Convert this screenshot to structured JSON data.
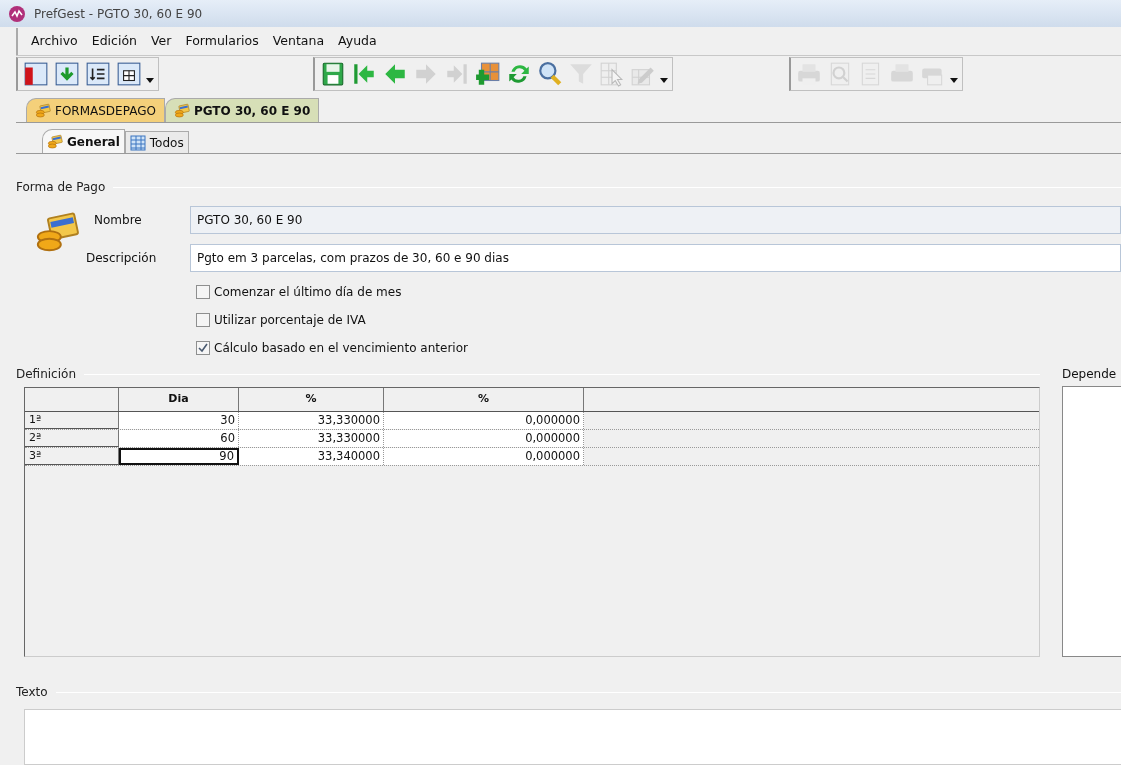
{
  "window": {
    "title": "PrefGest - PGTO 30, 60 E 90"
  },
  "menu": [
    "Archivo",
    "Edición",
    "Ver",
    "Formularios",
    "Ventana",
    "Ayuda"
  ],
  "toolbars": [
    {
      "items": [
        {
          "disabled": false
        },
        {
          "disabled": false
        },
        {
          "disabled": false
        },
        {
          "disabled": false
        }
      ]
    },
    {
      "items": [
        {
          "disabled": false
        },
        {
          "disabled": false
        },
        {
          "disabled": false
        },
        {
          "disabled": true
        },
        {
          "disabled": true
        },
        {
          "disabled": false
        },
        {
          "disabled": false
        },
        {
          "disabled": false
        },
        {
          "disabled": true
        },
        {
          "disabled": true
        },
        {
          "disabled": true
        }
      ]
    },
    {
      "items": [
        {
          "disabled": true
        },
        {
          "disabled": true
        },
        {
          "disabled": true
        },
        {
          "disabled": true
        },
        {
          "disabled": true
        }
      ]
    }
  ],
  "document_tabs": [
    {
      "label": "FORMASDEPAGO",
      "selected": false
    },
    {
      "label": "PGTO 30, 60 E 90",
      "selected": true
    }
  ],
  "tabs": [
    {
      "label": "General",
      "selected": true
    },
    {
      "label": "Todos",
      "selected": false
    }
  ],
  "forma_de_pago": {
    "legend": "Forma de Pago",
    "fields": [
      {
        "label": "Nombre",
        "value": "PGTO 30, 60 E 90"
      },
      {
        "label": "Descripción",
        "value": "Pgto em 3 parcelas, com prazos de 30, 60 e 90 dias"
      }
    ],
    "checkboxes": [
      {
        "label": "Comenzar el último día de mes",
        "checked": false
      },
      {
        "label": "Utilizar porcentaje de IVA",
        "checked": false
      },
      {
        "label": "Cálculo basado en el vencimiento anterior",
        "checked": true
      }
    ]
  },
  "definicion": {
    "legend": "Definición",
    "columns": [
      "Dia",
      "%",
      "%"
    ],
    "rows": [
      {
        "label": "1ª",
        "cells": [
          {
            "text": "30",
            "selected": false
          },
          {
            "text": "33,330000",
            "selected": false
          },
          {
            "text": "0,000000",
            "selected": false
          }
        ]
      },
      {
        "label": "2ª",
        "cells": [
          {
            "text": "60",
            "selected": false
          },
          {
            "text": "33,330000",
            "selected": false
          },
          {
            "text": "0,000000",
            "selected": false
          }
        ]
      },
      {
        "label": "3ª",
        "cells": [
          {
            "text": "90",
            "selected": true
          },
          {
            "text": "33,340000",
            "selected": false
          },
          {
            "text": "0,000000",
            "selected": false
          }
        ]
      }
    ]
  },
  "dependencias": {
    "legend": "Depende"
  },
  "texto": {
    "legend": "Texto"
  }
}
